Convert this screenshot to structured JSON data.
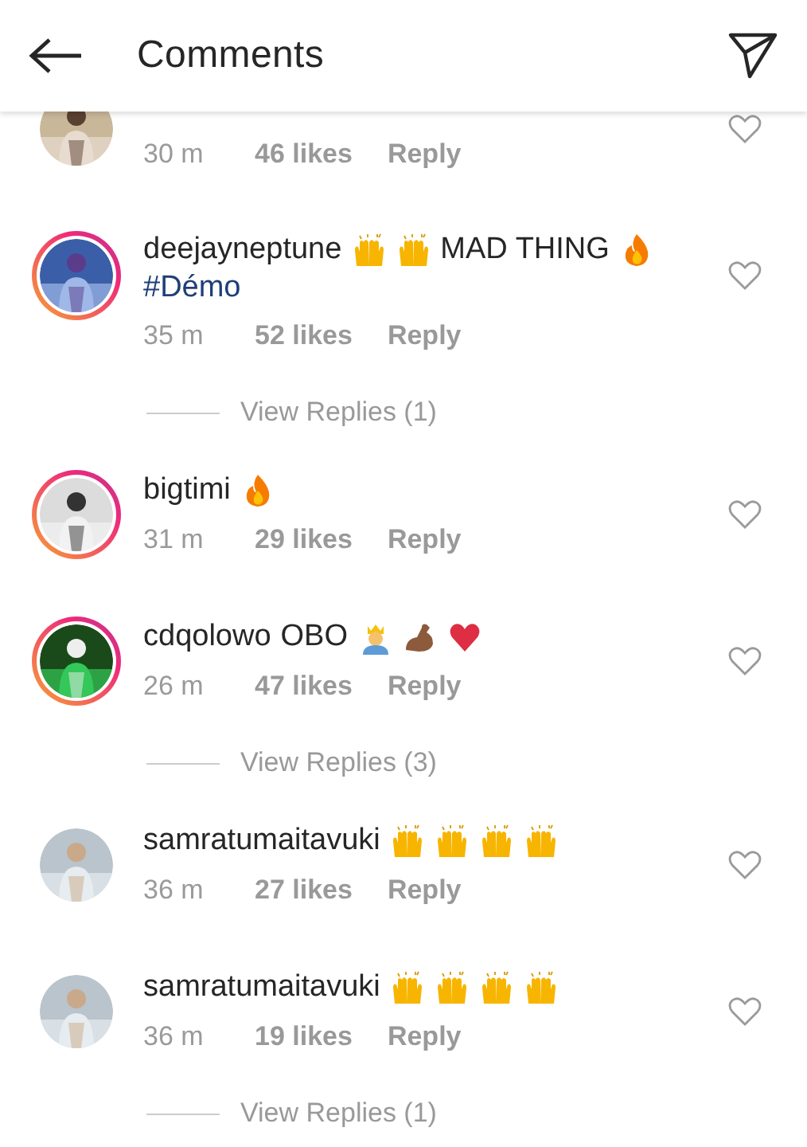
{
  "header": {
    "title": "Comments"
  },
  "comments": [
    {
      "story_ring": false,
      "time": "30 m",
      "likes": "46 likes",
      "reply": "Reply"
    },
    {
      "story_ring": true,
      "username": "deejayneptune",
      "parts": [
        {
          "kind": "hands"
        },
        {
          "kind": "hands"
        },
        {
          "kind": "text",
          "text": "MAD THING"
        },
        {
          "kind": "fire"
        },
        {
          "kind": "hashtag",
          "text": "#Démo"
        }
      ],
      "time": "35 m",
      "likes": "52 likes",
      "reply": "Reply",
      "view_replies": "View Replies (1)"
    },
    {
      "story_ring": true,
      "username": "bigtimi",
      "parts": [
        {
          "kind": "fire"
        }
      ],
      "time": "31 m",
      "likes": "29 likes",
      "reply": "Reply"
    },
    {
      "story_ring": true,
      "username": "cdqolowo",
      "parts": [
        {
          "kind": "text",
          "text": "OBO"
        },
        {
          "kind": "prince"
        },
        {
          "kind": "muscle"
        },
        {
          "kind": "heart"
        }
      ],
      "time": "26 m",
      "likes": "47 likes",
      "reply": "Reply",
      "view_replies": "View Replies (3)"
    },
    {
      "story_ring": false,
      "username": "samratumaitavuki",
      "parts": [
        {
          "kind": "hands"
        },
        {
          "kind": "hands"
        },
        {
          "kind": "hands"
        },
        {
          "kind": "hands"
        }
      ],
      "time": "36 m",
      "likes": "27 likes",
      "reply": "Reply"
    },
    {
      "story_ring": false,
      "username": "samratumaitavuki",
      "parts": [
        {
          "kind": "hands"
        },
        {
          "kind": "hands"
        },
        {
          "kind": "hands"
        },
        {
          "kind": "hands"
        }
      ],
      "time": "36 m",
      "likes": "19 likes",
      "reply": "Reply",
      "view_replies": "View Replies (1)"
    }
  ]
}
